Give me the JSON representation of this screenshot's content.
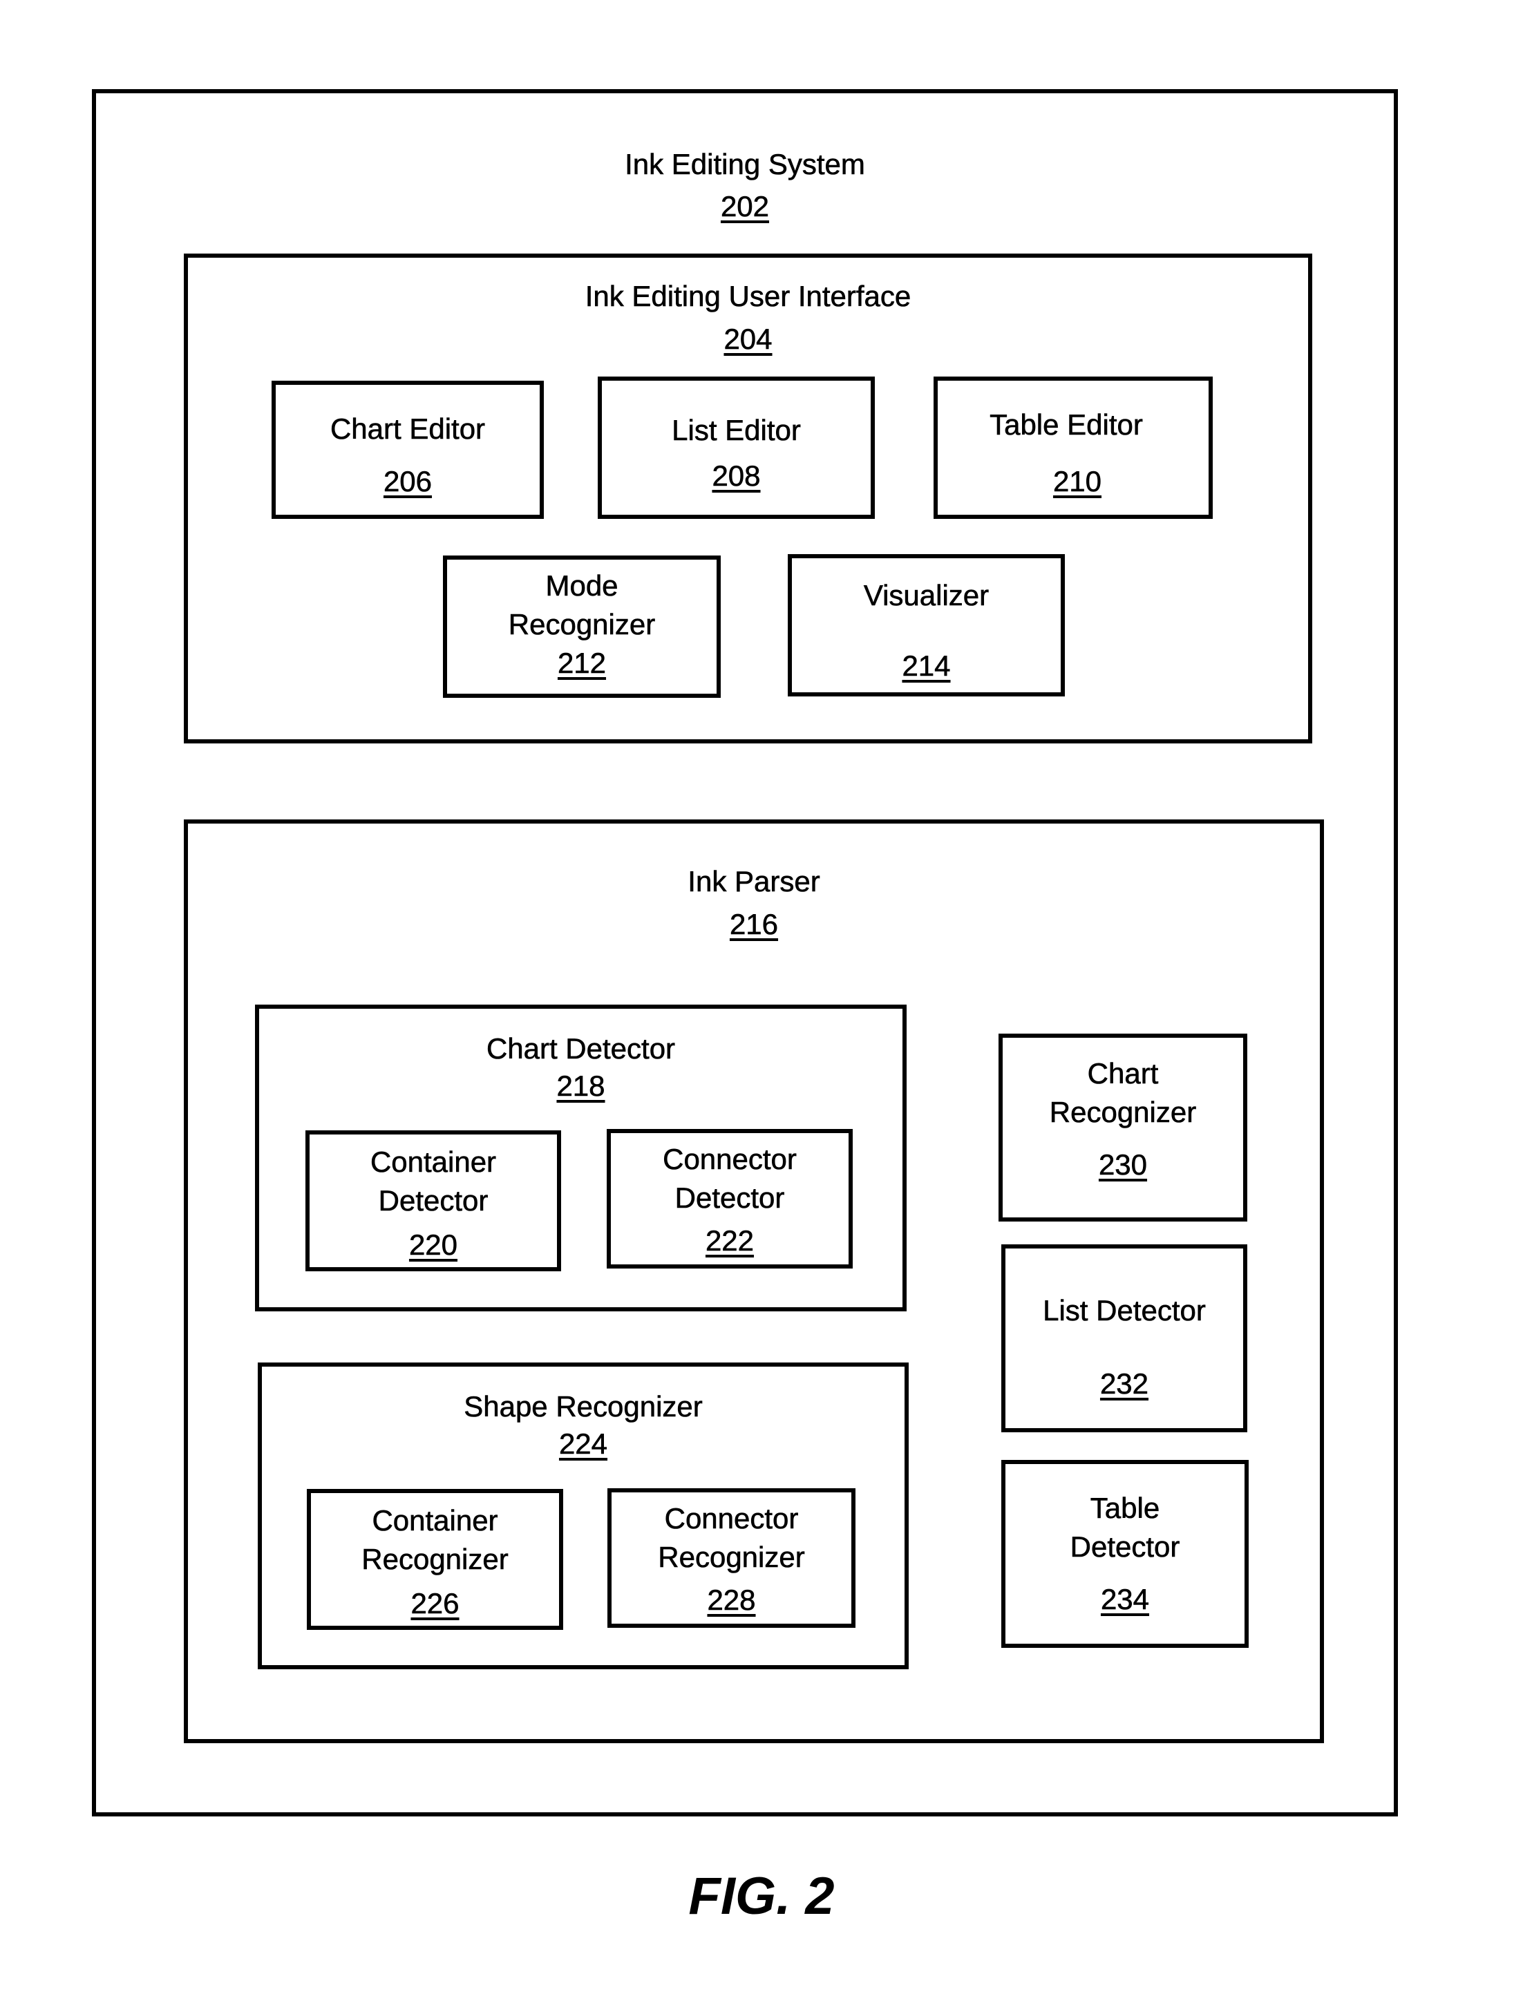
{
  "figure_label": "FIG. 2",
  "system": {
    "title": "Ink Editing System",
    "ref": "202",
    "user_interface": {
      "title": "Ink Editing User Interface",
      "ref": "204",
      "components": [
        {
          "lines": [
            "Chart Editor"
          ],
          "ref": "206"
        },
        {
          "lines": [
            "List Editor"
          ],
          "ref": "208"
        },
        {
          "lines": [
            "Table Editor"
          ],
          "ref": "210"
        },
        {
          "lines": [
            "Mode",
            "Recognizer"
          ],
          "ref": "212"
        },
        {
          "lines": [
            "Visualizer"
          ],
          "ref": "214"
        }
      ]
    },
    "ink_parser": {
      "title": "Ink Parser",
      "ref": "216",
      "chart_detector": {
        "title": "Chart Detector",
        "ref": "218",
        "components": [
          {
            "lines": [
              "Container",
              "Detector"
            ],
            "ref": "220"
          },
          {
            "lines": [
              "Connector",
              "Detector"
            ],
            "ref": "222"
          }
        ]
      },
      "shape_recognizer": {
        "title": "Shape Recognizer",
        "ref": "224",
        "components": [
          {
            "lines": [
              "Container",
              "Recognizer"
            ],
            "ref": "226"
          },
          {
            "lines": [
              "Connector",
              "Recognizer"
            ],
            "ref": "228"
          }
        ]
      },
      "side_components": [
        {
          "lines": [
            "Chart",
            "Recognizer"
          ],
          "ref": "230"
        },
        {
          "lines": [
            "List Detector"
          ],
          "ref": "232"
        },
        {
          "lines": [
            "Table",
            "Detector"
          ],
          "ref": "234"
        }
      ]
    }
  }
}
